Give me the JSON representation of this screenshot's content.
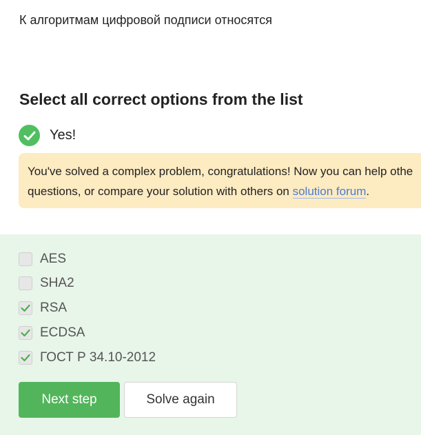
{
  "question": "К алгоритмам цифровой подписи относятся",
  "instruction": "Select all correct options from the list",
  "result": {
    "status": "correct",
    "text": "Yes!",
    "icon": "check-circle-icon",
    "color": "#4fbf5f"
  },
  "hint": {
    "line1": "You've solved a complex problem, congratulations! Now you can help othe",
    "line2_before": "questions, or compare your solution with others on ",
    "link_text": "solution forum",
    "line2_after": "."
  },
  "options": [
    {
      "label": "AES",
      "checked": false
    },
    {
      "label": "SHA2",
      "checked": false
    },
    {
      "label": "RSA",
      "checked": true
    },
    {
      "label": "ECDSA",
      "checked": true
    },
    {
      "label": "ГОСТ Р 34.10-2012",
      "checked": true
    }
  ],
  "buttons": {
    "next": "Next step",
    "solve_again": "Solve again"
  },
  "colors": {
    "accent_green": "#53b55b",
    "panel_bg": "#e8f5e9",
    "hint_bg": "#fdebc2",
    "link": "#4a7bd1"
  }
}
